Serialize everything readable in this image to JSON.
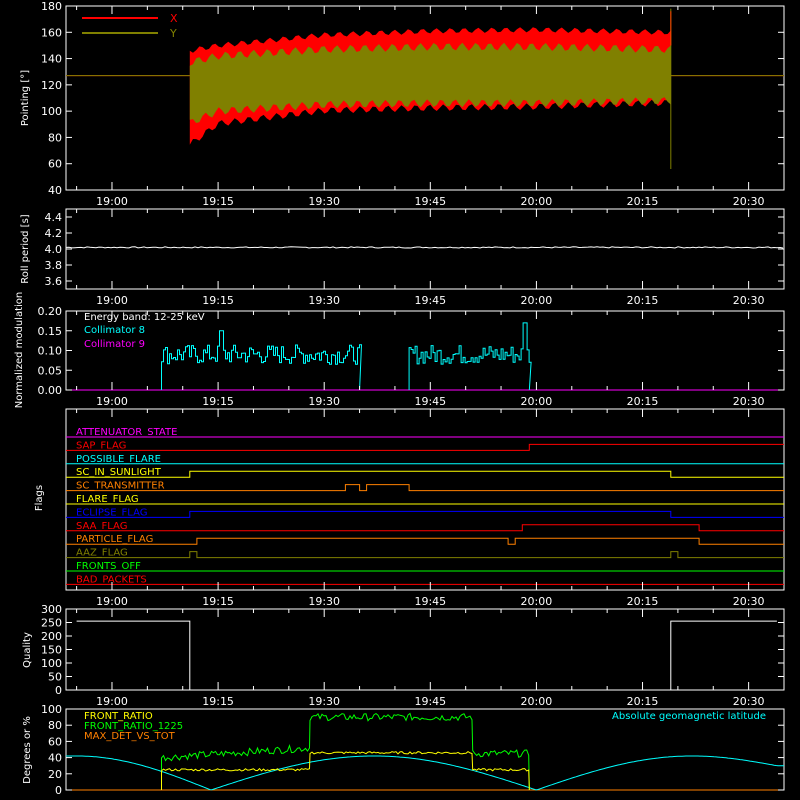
{
  "chart_data": [
    {
      "type": "line",
      "ylabel": "Pointing [°]",
      "ylim": [
        40,
        180
      ],
      "yticks": [
        40,
        60,
        80,
        100,
        120,
        140,
        160,
        180
      ],
      "xticks": [
        "19:00",
        "19:15",
        "19:30",
        "19:45",
        "20:00",
        "20:15",
        "20:30"
      ],
      "legend_placement": "top-left",
      "series": [
        {
          "name": "X",
          "color": "#ff0000",
          "flat_value": 127,
          "active_range": [
            "19:11",
            "20:19"
          ],
          "envelope_x": [
            "19:11",
            "19:15",
            "19:30",
            "19:45",
            "20:00",
            "20:19"
          ],
          "upper": [
            148,
            152,
            160,
            163,
            164,
            162
          ],
          "lower": [
            72,
            88,
            98,
            100,
            101,
            104
          ]
        },
        {
          "name": "Y",
          "color": "#808000",
          "flat_value": 127,
          "active_range": [
            "19:11",
            "20:19"
          ],
          "envelope_x": [
            "19:11",
            "19:15",
            "19:30",
            "19:45",
            "20:00",
            "20:19"
          ],
          "upper": [
            140,
            145,
            150,
            152,
            152,
            150
          ],
          "lower": [
            88,
            97,
            102,
            103,
            103,
            105
          ]
        }
      ]
    },
    {
      "type": "line",
      "ylabel": "Roll period [s]",
      "ylim": [
        3.5,
        4.5
      ],
      "yticks": [
        "3.6",
        "3.8",
        "4.0",
        "4.2",
        "4.4"
      ],
      "xticks": [
        "19:00",
        "19:15",
        "19:30",
        "19:45",
        "20:00",
        "20:15",
        "20:30"
      ],
      "series": [
        {
          "color": "#ffffff",
          "value": 4.02
        }
      ]
    },
    {
      "type": "line",
      "ylabel": "Normalized modulation",
      "ylim": [
        0.0,
        0.2
      ],
      "yticks": [
        "0.00",
        "0.05",
        "0.10",
        "0.15",
        "0.20"
      ],
      "xticks": [
        "19:00",
        "19:15",
        "19:30",
        "19:45",
        "20:00",
        "20:15",
        "20:30"
      ],
      "annotations": [
        "Energy band: 12-25 keV"
      ],
      "series": [
        {
          "name": "Collimator 8",
          "color": "#00ffff",
          "segments": [
            {
              "start": "19:07",
              "end": "19:35",
              "mean": 0.09
            },
            {
              "start": "19:42",
              "end": "19:59",
              "mean": 0.09
            }
          ],
          "peaks": [
            0.15,
            0.17
          ]
        },
        {
          "name": "Collimator 9",
          "color": "#ff00ff",
          "value": 0.0
        }
      ]
    },
    {
      "type": "line",
      "ylabel": "Flags",
      "xticks": [
        "19:00",
        "19:15",
        "19:30",
        "19:45",
        "20:00",
        "20:15",
        "20:30"
      ],
      "flags": [
        {
          "name": "ATTENUATOR_STATE",
          "color": "#ff00ff",
          "changes": []
        },
        {
          "name": "SAP_FLAG",
          "color": "#ff0000",
          "changes": [
            "19:59"
          ]
        },
        {
          "name": "POSSIBLE_FLARE",
          "color": "#00ffff",
          "changes": []
        },
        {
          "name": "SC_IN_SUNLIGHT",
          "color": "#ffff00",
          "changes": [
            "19:11",
            "20:19"
          ]
        },
        {
          "name": "SC_TRANSMITTER",
          "color": "#ff8000",
          "changes": [
            "19:33",
            "19:35",
            "19:36",
            "19:42"
          ]
        },
        {
          "name": "FLARE_FLAG",
          "color": "#ffff00",
          "changes": []
        },
        {
          "name": "ECLIPSE_FLAG",
          "color": "#0000ff",
          "changes": [
            "19:11",
            "20:19"
          ]
        },
        {
          "name": "SAA_FLAG",
          "color": "#ff0000",
          "changes": [
            "19:58",
            "20:23"
          ]
        },
        {
          "name": "PARTICLE_FLAG",
          "color": "#ff8000",
          "changes": [
            "19:12",
            "19:56",
            "19:57",
            "20:23"
          ]
        },
        {
          "name": "AAZ_FLAG",
          "color": "#808000",
          "changes": [
            "19:11",
            "19:12",
            "20:19",
            "20:20"
          ]
        },
        {
          "name": "FRONTS_OFF",
          "color": "#00ff00",
          "changes": []
        },
        {
          "name": "BAD_PACKETS",
          "color": "#ff0000",
          "changes": []
        }
      ]
    },
    {
      "type": "line",
      "ylabel": "Quality",
      "ylim": [
        0,
        300
      ],
      "yticks": [
        0,
        50,
        100,
        150,
        200,
        250,
        300
      ],
      "xticks": [
        "19:00",
        "19:15",
        "19:30",
        "19:45",
        "20:00",
        "20:15",
        "20:30"
      ],
      "series": [
        {
          "color": "#ffffff",
          "x": [
            "18:55",
            "19:11",
            "19:11",
            "20:19",
            "20:19",
            "20:34"
          ],
          "y": [
            255,
            255,
            0,
            0,
            255,
            255
          ]
        }
      ]
    },
    {
      "type": "line",
      "ylabel": "Degrees or %",
      "ylim": [
        0,
        100
      ],
      "yticks": [
        0,
        20,
        40,
        60,
        80,
        100
      ],
      "xticks": [
        "19:00",
        "19:15",
        "19:30",
        "19:45",
        "20:00",
        "20:15",
        "20:30"
      ],
      "series": [
        {
          "name": "FRONT_RATIO",
          "color": "#ffff00",
          "segments": [
            {
              "start": "19:07",
              "end": "19:28",
              "mean": 25
            },
            {
              "start": "19:28",
              "end": "19:51",
              "mean": 46
            },
            {
              "start": "19:51",
              "end": "19:59",
              "mean": 25
            }
          ]
        },
        {
          "name": "FRONT_RATIO_1225",
          "color": "#00ff00",
          "segments": [
            {
              "start": "19:07",
              "end": "19:28",
              "mean": 40
            },
            {
              "start": "19:28",
              "end": "19:51",
              "mean": 90
            },
            {
              "start": "19:51",
              "end": "19:59",
              "mean": 45
            }
          ]
        },
        {
          "name": "MAX_DET_VS_TOT",
          "color": "#ff8000",
          "value": 0
        },
        {
          "name": "Absolute geomagnetic latitude",
          "color": "#00ffff",
          "x": [
            "18:55",
            "19:14",
            "19:37",
            "20:00",
            "20:22",
            "20:34"
          ],
          "y": [
            42,
            0,
            42,
            0,
            42,
            30
          ]
        }
      ]
    }
  ]
}
